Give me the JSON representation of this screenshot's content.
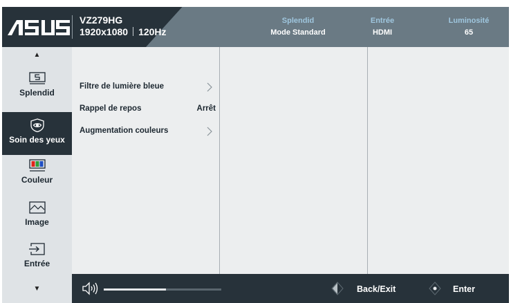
{
  "header": {
    "brand": "ASUS",
    "model": "VZ279HG",
    "resolution": "1920x1080",
    "refresh": "120Hz",
    "splendid": {
      "label": "Splendid",
      "value": "Mode Standard"
    },
    "input": {
      "label": "Entrée",
      "value": "HDMI"
    },
    "brightness": {
      "label": "Luminosité",
      "value": "65"
    }
  },
  "sidebar": {
    "items": [
      {
        "label": "Splendid",
        "icon": "splendid-icon"
      },
      {
        "label": "Soin des yeux",
        "icon": "eye-care-icon",
        "active": true
      },
      {
        "label": "Couleur",
        "icon": "color-icon"
      },
      {
        "label": "Image",
        "icon": "image-icon"
      },
      {
        "label": "Entrée",
        "icon": "input-icon"
      }
    ]
  },
  "menu": {
    "items": [
      {
        "label": "Filtre de lumière bleue",
        "value": "",
        "submenu": true
      },
      {
        "label": "Rappel de repos",
        "value": "Arrêt",
        "submenu": false
      },
      {
        "label": "Augmentation couleurs",
        "value": "",
        "submenu": true
      }
    ]
  },
  "footer": {
    "volume_level": 0.53,
    "back_label": "Back/Exit",
    "enter_label": "Enter"
  },
  "colors": {
    "header_bg": "#27323a",
    "header_panel": "#6a7a84",
    "accent_label": "#9fc6de",
    "content_bg": "#eceeef",
    "sidebar_bg": "#dfe3e6"
  }
}
